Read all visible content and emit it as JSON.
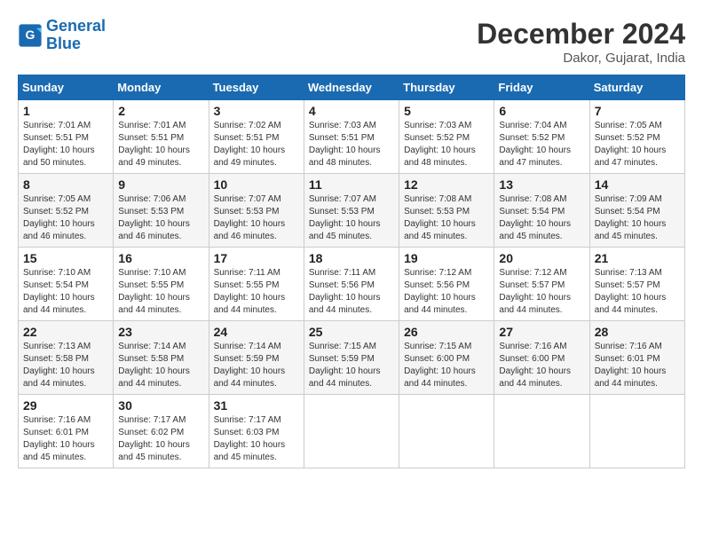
{
  "logo": {
    "line1": "General",
    "line2": "Blue"
  },
  "header": {
    "month": "December 2024",
    "location": "Dakor, Gujarat, India"
  },
  "weekdays": [
    "Sunday",
    "Monday",
    "Tuesday",
    "Wednesday",
    "Thursday",
    "Friday",
    "Saturday"
  ],
  "weeks": [
    [
      {
        "day": "1",
        "sunrise": "7:01 AM",
        "sunset": "5:51 PM",
        "daylight": "10 hours and 50 minutes."
      },
      {
        "day": "2",
        "sunrise": "7:01 AM",
        "sunset": "5:51 PM",
        "daylight": "10 hours and 49 minutes."
      },
      {
        "day": "3",
        "sunrise": "7:02 AM",
        "sunset": "5:51 PM",
        "daylight": "10 hours and 49 minutes."
      },
      {
        "day": "4",
        "sunrise": "7:03 AM",
        "sunset": "5:51 PM",
        "daylight": "10 hours and 48 minutes."
      },
      {
        "day": "5",
        "sunrise": "7:03 AM",
        "sunset": "5:52 PM",
        "daylight": "10 hours and 48 minutes."
      },
      {
        "day": "6",
        "sunrise": "7:04 AM",
        "sunset": "5:52 PM",
        "daylight": "10 hours and 47 minutes."
      },
      {
        "day": "7",
        "sunrise": "7:05 AM",
        "sunset": "5:52 PM",
        "daylight": "10 hours and 47 minutes."
      }
    ],
    [
      {
        "day": "8",
        "sunrise": "7:05 AM",
        "sunset": "5:52 PM",
        "daylight": "10 hours and 46 minutes."
      },
      {
        "day": "9",
        "sunrise": "7:06 AM",
        "sunset": "5:53 PM",
        "daylight": "10 hours and 46 minutes."
      },
      {
        "day": "10",
        "sunrise": "7:07 AM",
        "sunset": "5:53 PM",
        "daylight": "10 hours and 46 minutes."
      },
      {
        "day": "11",
        "sunrise": "7:07 AM",
        "sunset": "5:53 PM",
        "daylight": "10 hours and 45 minutes."
      },
      {
        "day": "12",
        "sunrise": "7:08 AM",
        "sunset": "5:53 PM",
        "daylight": "10 hours and 45 minutes."
      },
      {
        "day": "13",
        "sunrise": "7:08 AM",
        "sunset": "5:54 PM",
        "daylight": "10 hours and 45 minutes."
      },
      {
        "day": "14",
        "sunrise": "7:09 AM",
        "sunset": "5:54 PM",
        "daylight": "10 hours and 45 minutes."
      }
    ],
    [
      {
        "day": "15",
        "sunrise": "7:10 AM",
        "sunset": "5:54 PM",
        "daylight": "10 hours and 44 minutes."
      },
      {
        "day": "16",
        "sunrise": "7:10 AM",
        "sunset": "5:55 PM",
        "daylight": "10 hours and 44 minutes."
      },
      {
        "day": "17",
        "sunrise": "7:11 AM",
        "sunset": "5:55 PM",
        "daylight": "10 hours and 44 minutes."
      },
      {
        "day": "18",
        "sunrise": "7:11 AM",
        "sunset": "5:56 PM",
        "daylight": "10 hours and 44 minutes."
      },
      {
        "day": "19",
        "sunrise": "7:12 AM",
        "sunset": "5:56 PM",
        "daylight": "10 hours and 44 minutes."
      },
      {
        "day": "20",
        "sunrise": "7:12 AM",
        "sunset": "5:57 PM",
        "daylight": "10 hours and 44 minutes."
      },
      {
        "day": "21",
        "sunrise": "7:13 AM",
        "sunset": "5:57 PM",
        "daylight": "10 hours and 44 minutes."
      }
    ],
    [
      {
        "day": "22",
        "sunrise": "7:13 AM",
        "sunset": "5:58 PM",
        "daylight": "10 hours and 44 minutes."
      },
      {
        "day": "23",
        "sunrise": "7:14 AM",
        "sunset": "5:58 PM",
        "daylight": "10 hours and 44 minutes."
      },
      {
        "day": "24",
        "sunrise": "7:14 AM",
        "sunset": "5:59 PM",
        "daylight": "10 hours and 44 minutes."
      },
      {
        "day": "25",
        "sunrise": "7:15 AM",
        "sunset": "5:59 PM",
        "daylight": "10 hours and 44 minutes."
      },
      {
        "day": "26",
        "sunrise": "7:15 AM",
        "sunset": "6:00 PM",
        "daylight": "10 hours and 44 minutes."
      },
      {
        "day": "27",
        "sunrise": "7:16 AM",
        "sunset": "6:00 PM",
        "daylight": "10 hours and 44 minutes."
      },
      {
        "day": "28",
        "sunrise": "7:16 AM",
        "sunset": "6:01 PM",
        "daylight": "10 hours and 44 minutes."
      }
    ],
    [
      {
        "day": "29",
        "sunrise": "7:16 AM",
        "sunset": "6:01 PM",
        "daylight": "10 hours and 45 minutes."
      },
      {
        "day": "30",
        "sunrise": "7:17 AM",
        "sunset": "6:02 PM",
        "daylight": "10 hours and 45 minutes."
      },
      {
        "day": "31",
        "sunrise": "7:17 AM",
        "sunset": "6:03 PM",
        "daylight": "10 hours and 45 minutes."
      },
      null,
      null,
      null,
      null
    ]
  ]
}
